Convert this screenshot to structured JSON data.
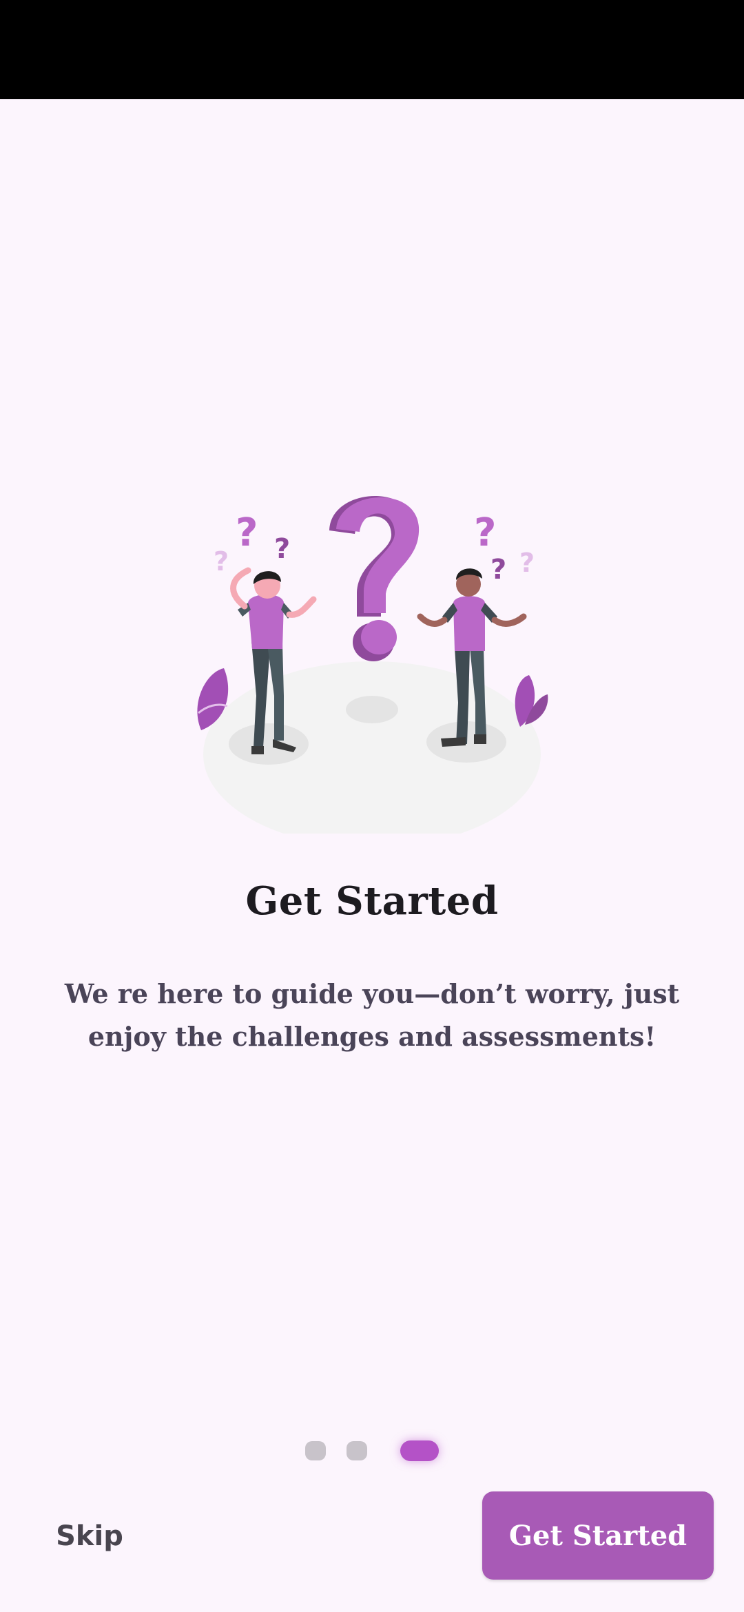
{
  "onboarding": {
    "title": "Get Started",
    "description": "We re here to guide you—don’t worry, just enjoy the challenges and assessments!"
  },
  "pagination": {
    "total_pages": 3,
    "current_page": 3
  },
  "footer": {
    "skip_label": "Skip",
    "primary_label": "Get Started"
  },
  "colors": {
    "background": "#fcf5fd",
    "accent": "#a85ab6",
    "active_dot": "#b452c7",
    "inactive_dot": "#c8c3ca",
    "title_text": "#1d1b20",
    "body_text": "#4a4458"
  }
}
